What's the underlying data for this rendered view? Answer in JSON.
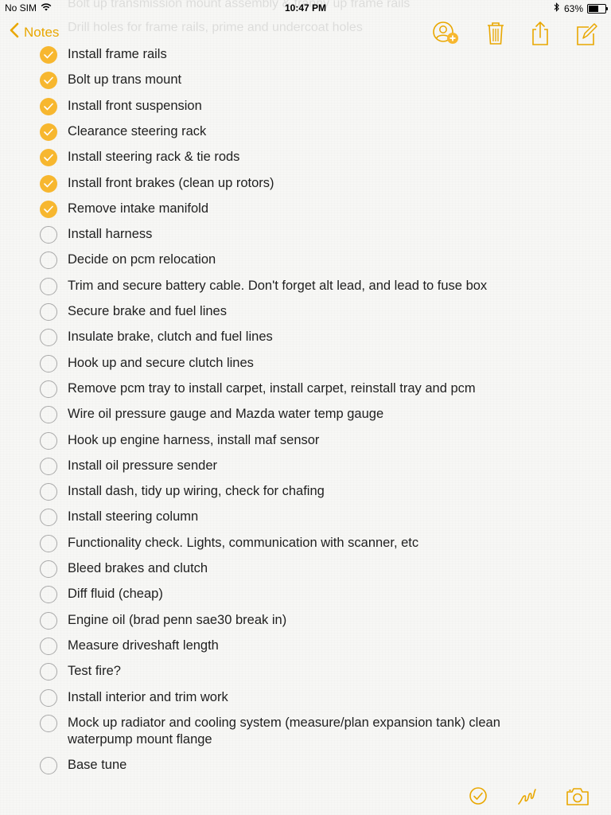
{
  "status_bar": {
    "carrier": "No SIM",
    "time": "10:47 PM",
    "battery_percent": "63%",
    "battery_level": 0.63
  },
  "ghost_text": {
    "line1": "Bolt up transmission mount assembly & tranny up frame rails",
    "line2": "Drill holes for frame rails, prime and undercoat holes"
  },
  "nav": {
    "back_label": "Notes",
    "icons": [
      "add-person-icon",
      "trash-icon",
      "share-icon",
      "compose-icon"
    ]
  },
  "accent_color": "#f7b72f",
  "checklist": [
    {
      "label": "Install frame rails",
      "checked": true
    },
    {
      "label": "Bolt up trans mount",
      "checked": true
    },
    {
      "label": "Install front suspension",
      "checked": true
    },
    {
      "label": "Clearance steering rack",
      "checked": true
    },
    {
      "label": "Install steering rack & tie rods",
      "checked": true
    },
    {
      "label": "Install front brakes (clean up rotors)",
      "checked": true
    },
    {
      "label": "Remove intake manifold",
      "checked": true
    },
    {
      "label": "Install harness",
      "checked": false
    },
    {
      "label": "Decide on pcm relocation",
      "checked": false
    },
    {
      "label": "Trim and secure battery cable. Don't forget alt lead, and lead to fuse box",
      "checked": false
    },
    {
      "label": "Secure brake and fuel lines",
      "checked": false
    },
    {
      "label": "Insulate brake, clutch and fuel lines",
      "checked": false
    },
    {
      "label": "Hook up and secure clutch lines",
      "checked": false
    },
    {
      "label": "Remove pcm tray to install carpet, install carpet, reinstall tray and pcm",
      "checked": false
    },
    {
      "label": "Wire oil pressure gauge and Mazda water temp gauge",
      "checked": false
    },
    {
      "label": "Hook up engine harness, install maf sensor",
      "checked": false
    },
    {
      "label": "Install oil pressure sender",
      "checked": false
    },
    {
      "label": "Install dash, tidy up wiring, check for chafing",
      "checked": false
    },
    {
      "label": "Install steering column",
      "checked": false
    },
    {
      "label": "Functionality check. Lights, communication with scanner, etc",
      "checked": false
    },
    {
      "label": "Bleed brakes and clutch",
      "checked": false
    },
    {
      "label": "Diff fluid (cheap)",
      "checked": false
    },
    {
      "label": "Engine oil (brad penn sae30 break in)",
      "checked": false
    },
    {
      "label": "Measure driveshaft length",
      "checked": false
    },
    {
      "label": "Test fire?",
      "checked": false
    },
    {
      "label": "Install interior and trim work",
      "checked": false
    },
    {
      "label": "Mock up radiator and cooling system (measure/plan expansion tank) clean waterpump mount flange",
      "checked": false
    },
    {
      "label": "Base tune",
      "checked": false
    }
  ],
  "bottom_toolbar": {
    "icons": [
      "checklist-icon",
      "sketch-icon",
      "camera-icon"
    ]
  }
}
